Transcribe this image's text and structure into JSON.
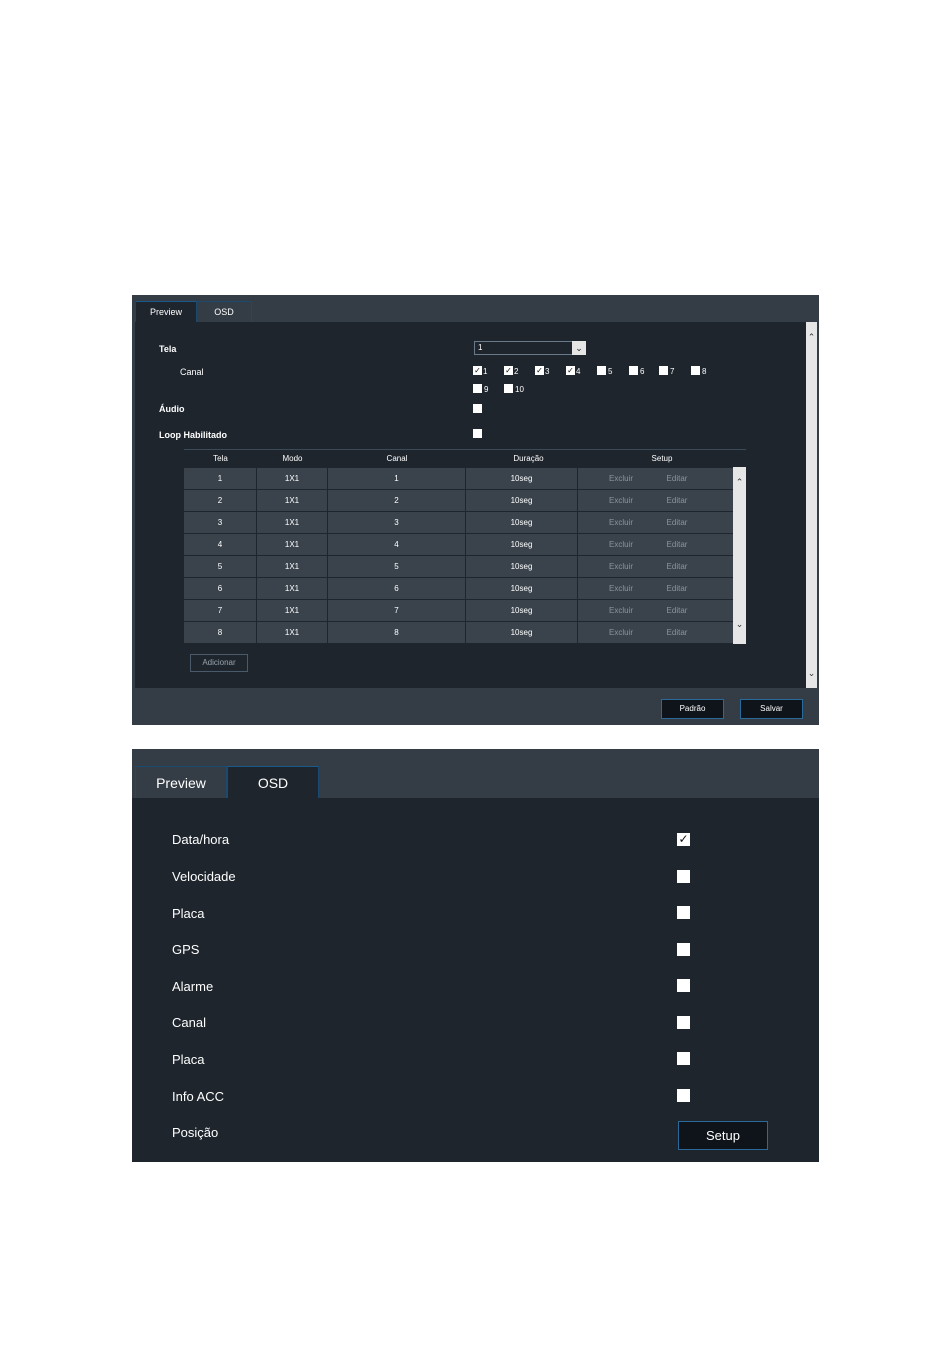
{
  "preview_panel": {
    "tabs": [
      "Preview",
      "OSD"
    ],
    "tela_label": "Tela",
    "tela_value": "1",
    "canal_label": "Canal",
    "channels": [
      {
        "label": "1",
        "checked": true
      },
      {
        "label": "2",
        "checked": true
      },
      {
        "label": "3",
        "checked": true
      },
      {
        "label": "4",
        "checked": true
      },
      {
        "label": "5",
        "checked": false
      },
      {
        "label": "6",
        "checked": false
      },
      {
        "label": "7",
        "checked": false
      },
      {
        "label": "8",
        "checked": false
      },
      {
        "label": "9",
        "checked": false
      },
      {
        "label": "10",
        "checked": false
      }
    ],
    "audio_label": "Áudio",
    "audio_checked": false,
    "loop_label": "Loop Habilitado",
    "loop_checked": false,
    "table": {
      "headers": [
        "Tela",
        "Modo",
        "Canal",
        "Duração",
        "Setup"
      ],
      "rows": [
        {
          "tela": "1",
          "modo": "1X1",
          "canal": "1",
          "duracao": "10seg"
        },
        {
          "tela": "2",
          "modo": "1X1",
          "canal": "2",
          "duracao": "10seg"
        },
        {
          "tela": "3",
          "modo": "1X1",
          "canal": "3",
          "duracao": "10seg"
        },
        {
          "tela": "4",
          "modo": "1X1",
          "canal": "4",
          "duracao": "10seg"
        },
        {
          "tela": "5",
          "modo": "1X1",
          "canal": "5",
          "duracao": "10seg"
        },
        {
          "tela": "6",
          "modo": "1X1",
          "canal": "6",
          "duracao": "10seg"
        },
        {
          "tela": "7",
          "modo": "1X1",
          "canal": "7",
          "duracao": "10seg"
        },
        {
          "tela": "8",
          "modo": "1X1",
          "canal": "8",
          "duracao": "10seg"
        }
      ],
      "excluir_label": "Excluir",
      "editar_label": "Editar"
    },
    "add_button": "Adicionar",
    "default_button": "Padrão",
    "save_button": "Salvar"
  },
  "osd_panel": {
    "tabs": [
      "Preview",
      "OSD"
    ],
    "items": [
      {
        "label": "Data/hora",
        "checked": true
      },
      {
        "label": "Velocidade",
        "checked": false
      },
      {
        "label": "Placa",
        "checked": false
      },
      {
        "label": "GPS",
        "checked": false
      },
      {
        "label": "Alarme",
        "checked": false
      },
      {
        "label": "Canal",
        "checked": false
      },
      {
        "label": "Placa",
        "checked": false
      },
      {
        "label": "Info ACC",
        "checked": false
      }
    ],
    "position_label": "Posição",
    "setup_button": "Setup"
  }
}
